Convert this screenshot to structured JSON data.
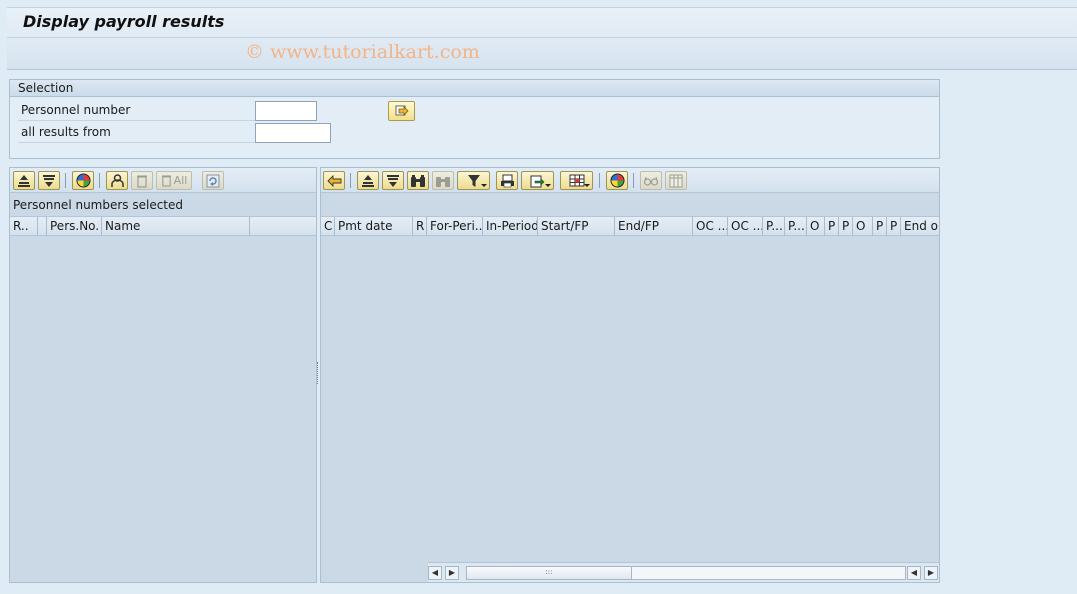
{
  "title": "Display payroll results",
  "watermark": "© www.tutorialkart.com",
  "selection": {
    "header": "Selection",
    "personnel_number_label": "Personnel number",
    "personnel_number_value": "",
    "all_results_from_label": "all results from",
    "all_results_from_value": ""
  },
  "left_panel": {
    "all_button_label": "All",
    "caption": "Personnel numbers selected",
    "columns": [
      "R..",
      "Pers.No.",
      "Name"
    ]
  },
  "right_panel": {
    "columns": [
      "C",
      "Pmt date",
      "R",
      "For-Peri...",
      "In-Period",
      "Start/FP",
      "End/FP",
      "OC ...",
      "OC ...",
      "P...",
      "P...",
      "O",
      "P",
      "P",
      "O",
      "P",
      "P",
      "End o"
    ]
  },
  "scrollbar": {
    "thumb_grip": ":::"
  },
  "colors": {
    "background": "#dfebf5",
    "panel": "#cbd9e7",
    "button_yellow": "#f2e18a",
    "watermark": "#f3b487"
  }
}
